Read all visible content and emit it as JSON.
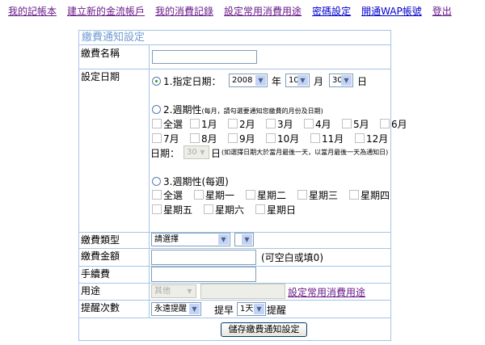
{
  "nav": [
    "我的記帳本",
    "建立新的金流帳戶",
    "我的消費記錄",
    "設定常用消費用途",
    "密碼設定",
    "開通WAP帳號",
    "登出"
  ],
  "form": {
    "title": "繳費通知設定",
    "name_label": "繳費名稱",
    "date_label": "設定日期",
    "opt1": "1.指定日期：",
    "year": "2008",
    "year_unit": "年",
    "month": "10",
    "month_unit": "月",
    "day": "30",
    "day_unit": "日",
    "opt2": "2.週期性",
    "opt2_note": "(每月，請勾選要通知您繳費的月份及日期)",
    "select_all": "全選",
    "months": [
      "1月",
      "2月",
      "3月",
      "4月",
      "5月",
      "6月",
      "7月",
      "8月",
      "9月",
      "10月",
      "11月",
      "12月"
    ],
    "date_prefix": "日期：",
    "monthly_day": "30",
    "monthly_day_unit": "日",
    "monthly_note": "(如選擇日期大於當月最後一天，以當月最後一天為通知日)",
    "opt3": "3.週期性(每週)",
    "weekdays": [
      "星期一",
      "星期二",
      "星期三",
      "星期四",
      "星期五",
      "星期六",
      "星期日"
    ],
    "type_label": "繳費類型",
    "type_value": "請選擇",
    "subtype_value": "",
    "amount_label": "繳費金額",
    "amount_note": "(可空白或填0)",
    "fee_label": "手續費",
    "purpose_label": "用途",
    "purpose_value": "其他",
    "purpose_link": "設定常用消費用途",
    "remind_label": "提醒次數",
    "remind_value": "永遠提醒",
    "advance_label": "提早",
    "advance_value": "1天",
    "advance_suffix": "提醒",
    "save": "儲存繳費通知設定"
  }
}
